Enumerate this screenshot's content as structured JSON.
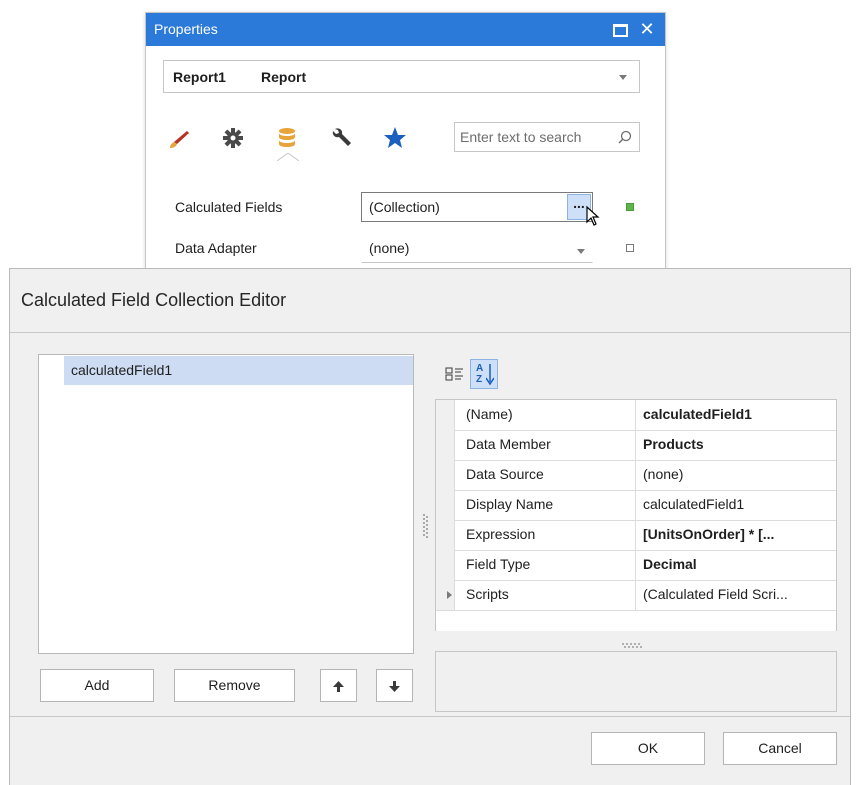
{
  "properties_panel": {
    "title": "Properties",
    "object_name": "Report1",
    "object_type": "Report",
    "search_placeholder": "Enter text to search",
    "tabs": [
      "brush-icon",
      "gear-icon",
      "database-icon",
      "wrench-icon",
      "star-icon"
    ],
    "active_tab": "database-icon",
    "rows": [
      {
        "label": "Calculated Fields",
        "value": "(Collection)",
        "ellipsis": "..."
      },
      {
        "label": "Data Adapter",
        "value": "(none)"
      }
    ],
    "colors": {
      "title_bar": "#2b79d8",
      "active_tab": "#e8a33a",
      "star": "#1b5fbf",
      "brush": "#b83222",
      "marker_set": "#5fb54a"
    }
  },
  "editor": {
    "title": "Calculated Field Collection Editor",
    "list_items": [
      "calculatedField1"
    ],
    "buttons": {
      "add": "Add",
      "remove": "Remove",
      "ok": "OK",
      "cancel": "Cancel"
    },
    "sort_button_text": "A Z",
    "property_grid": [
      {
        "name": "(Name)",
        "value": "calculatedField1",
        "bold": true
      },
      {
        "name": "Data Member",
        "value": "Products",
        "bold": true
      },
      {
        "name": "Data Source",
        "value": "(none)",
        "bold": false
      },
      {
        "name": "Display Name",
        "value": "calculatedField1",
        "bold": false
      },
      {
        "name": "Expression",
        "value": "[UnitsOnOrder] * [...",
        "bold": true
      },
      {
        "name": "Field Type",
        "value": "Decimal",
        "bold": true
      },
      {
        "name": "Scripts",
        "value": "(Calculated Field Scri...",
        "bold": false,
        "expandable": true
      }
    ],
    "colors": {
      "list_selection": "#cddcf2"
    }
  }
}
